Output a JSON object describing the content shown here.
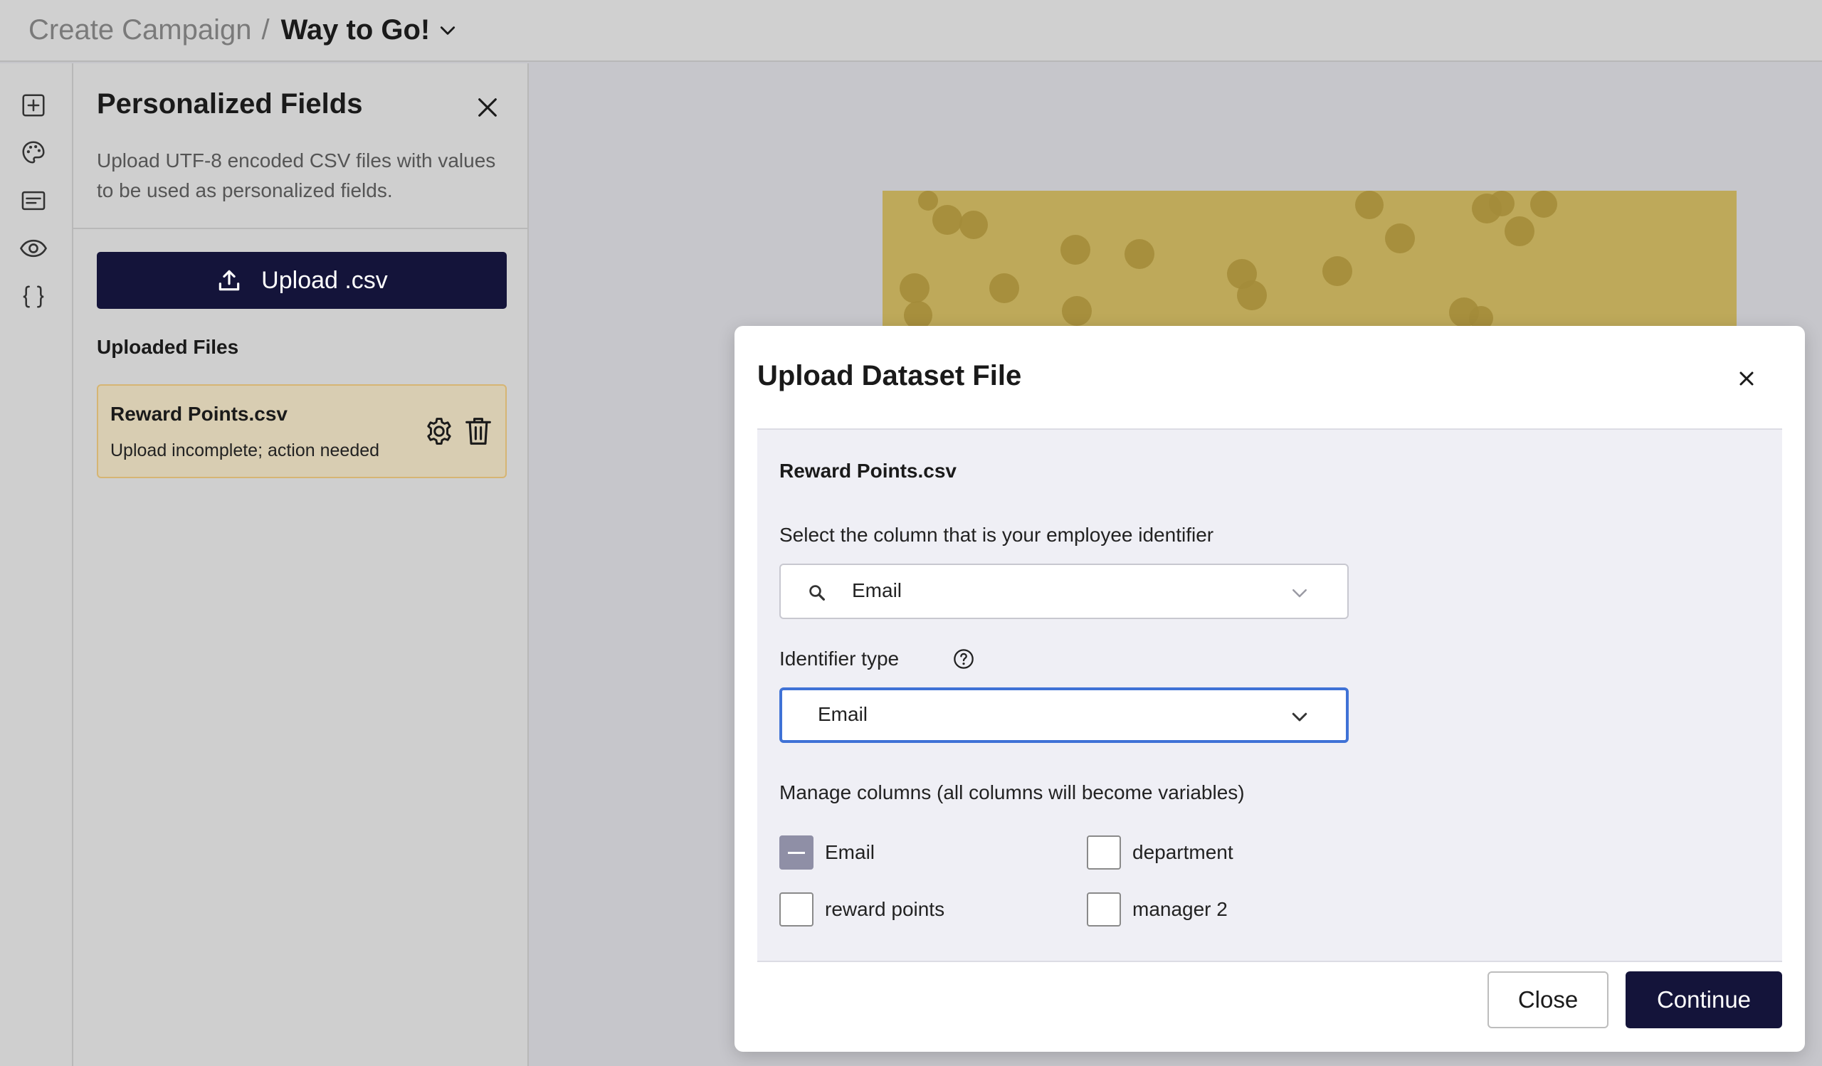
{
  "header": {
    "breadcrumb_root": "Create Campaign",
    "separator": "/",
    "campaign_name": "Way to Go!",
    "campaign_menu_icon": "chevron-down-icon"
  },
  "rail": {
    "icons": [
      "add-block-icon",
      "palette-icon",
      "text-block-icon",
      "preview-eye-icon",
      "code-braces-icon"
    ]
  },
  "panel": {
    "title": "Personalized Fields",
    "close_icon": "close-icon",
    "description": "Upload UTF-8 encoded CSV files with values to be used as personalized fields.",
    "upload_label": "Upload .csv",
    "uploaded_heading": "Uploaded Files",
    "files": [
      {
        "name": "Reward Points.csv",
        "status": "Upload incomplete; action needed",
        "status_color": "#d6b573"
      }
    ]
  },
  "modal": {
    "title": "Upload Dataset File",
    "file_name": "Reward Points.csv",
    "identifier_column_label": "Select the column that is your employee identifier",
    "identifier_column_value": "Email",
    "identifier_type_label": "Identifier type",
    "identifier_type_value": "Email",
    "manage_columns_label": "Manage columns (all columns will become variables)",
    "columns": [
      {
        "label": "Email",
        "state": "indeterminate"
      },
      {
        "label": "department",
        "state": "unchecked"
      },
      {
        "label": "reward points",
        "state": "unchecked"
      },
      {
        "label": "manager 2",
        "state": "unchecked"
      }
    ],
    "close_label": "Close",
    "continue_label": "Continue"
  },
  "colors": {
    "primary": "#14143a",
    "focus_border": "#3f72d6",
    "warning_card_bg": "#d8cdb2"
  }
}
